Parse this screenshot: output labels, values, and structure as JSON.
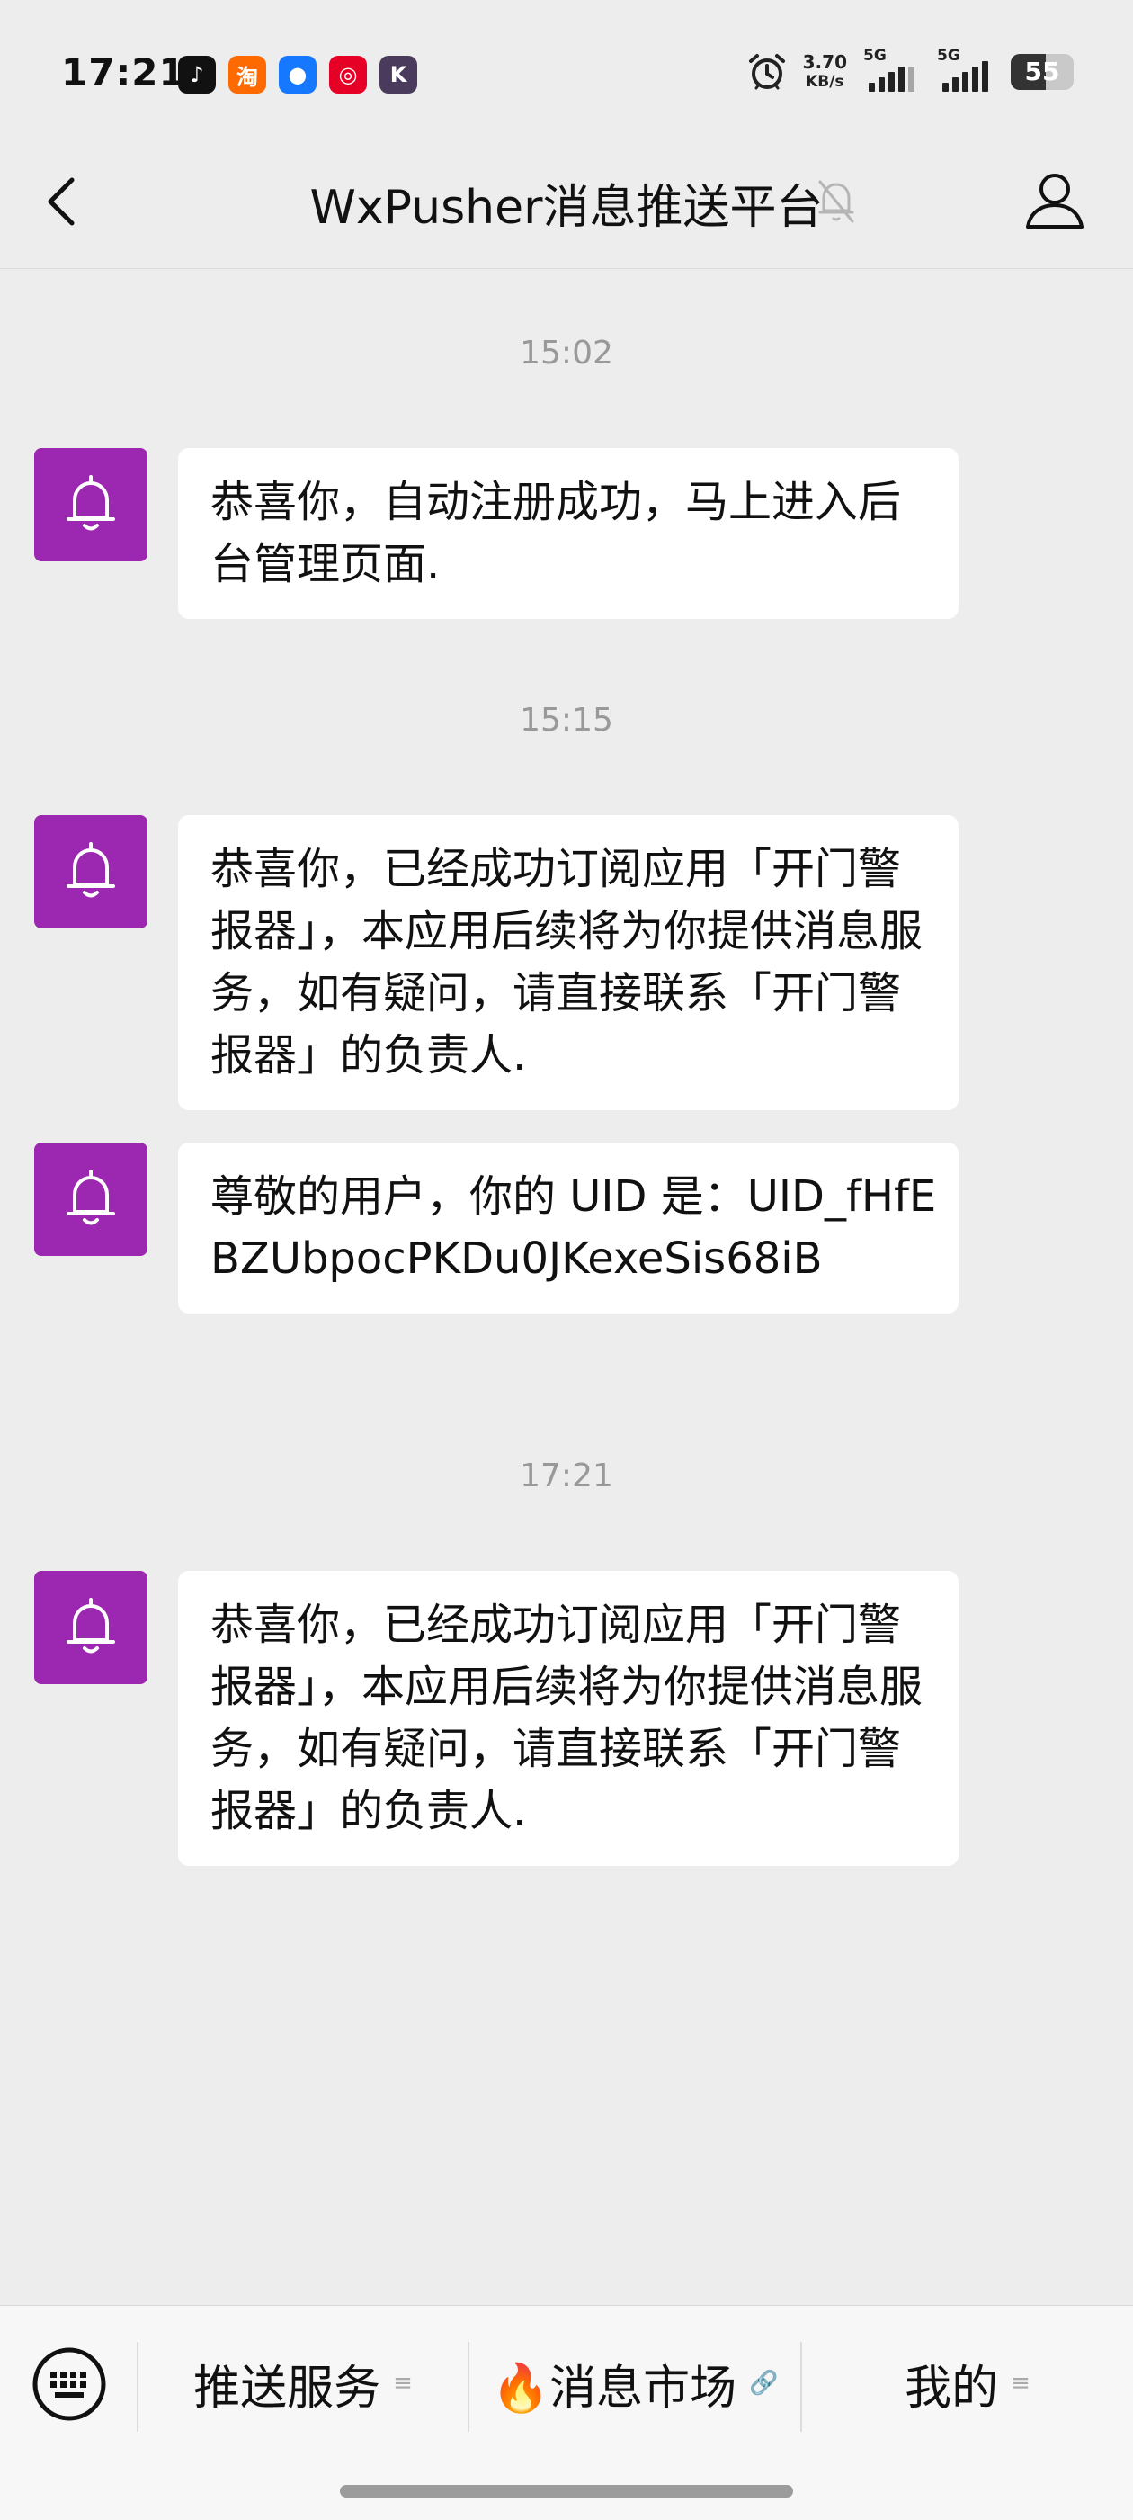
{
  "status_bar": {
    "time": "17:21",
    "apps": [
      {
        "icon": "qq-music-icon",
        "color": "#111111",
        "glyph": "♪"
      },
      {
        "icon": "taobao-icon",
        "color": "#ff6a00",
        "glyph": "淘"
      },
      {
        "icon": "alipay-bird-icon",
        "color": "#1677ff",
        "glyph": "●"
      },
      {
        "icon": "netease-music-icon",
        "color": "#e60026",
        "glyph": "◎"
      },
      {
        "icon": "kwai-icon",
        "color": "#4a3a5c",
        "glyph": "K"
      }
    ],
    "net_speed_value": "3.70",
    "net_speed_unit": "KB/s",
    "signal_label_1": "5G",
    "signal_label_2": "5G",
    "battery": "55",
    "battery_level": 0.55
  },
  "navbar": {
    "title": "WxPusher消息推送平台"
  },
  "messages": [
    {
      "type": "time",
      "text": "15:02"
    },
    {
      "type": "msg",
      "text": "恭喜你，自动注册成功，马上进入后台管理页面."
    },
    {
      "type": "time",
      "text": "15:15"
    },
    {
      "type": "msg",
      "text": "恭喜你，已经成功订阅应用「开门警报器」，本应用后续将为你提供消息服务，如有疑问，请直接联系「开门警报器」的负责人."
    },
    {
      "type": "msg",
      "text": "尊敬的用户，你的 UID 是：UID_fHfEBZUbpocPKDu0JKexeSis68iB"
    },
    {
      "type": "time",
      "text": "17:21"
    },
    {
      "type": "msg",
      "text": "恭喜你，已经成功订阅应用「开门警报器」，本应用后续将为你提供消息服务，如有疑问，请直接联系「开门警报器」的负责人."
    }
  ],
  "tabbar": {
    "tabs": [
      {
        "label": "推送服务",
        "indicator": "≡"
      },
      {
        "label": "🔥消息市场",
        "indicator": "🔗"
      },
      {
        "label": "我的",
        "indicator": "≡"
      }
    ]
  },
  "colors": {
    "avatar_bg": "#9c27b0",
    "page_bg": "#ededed",
    "bubble_bg": "#ffffff"
  }
}
